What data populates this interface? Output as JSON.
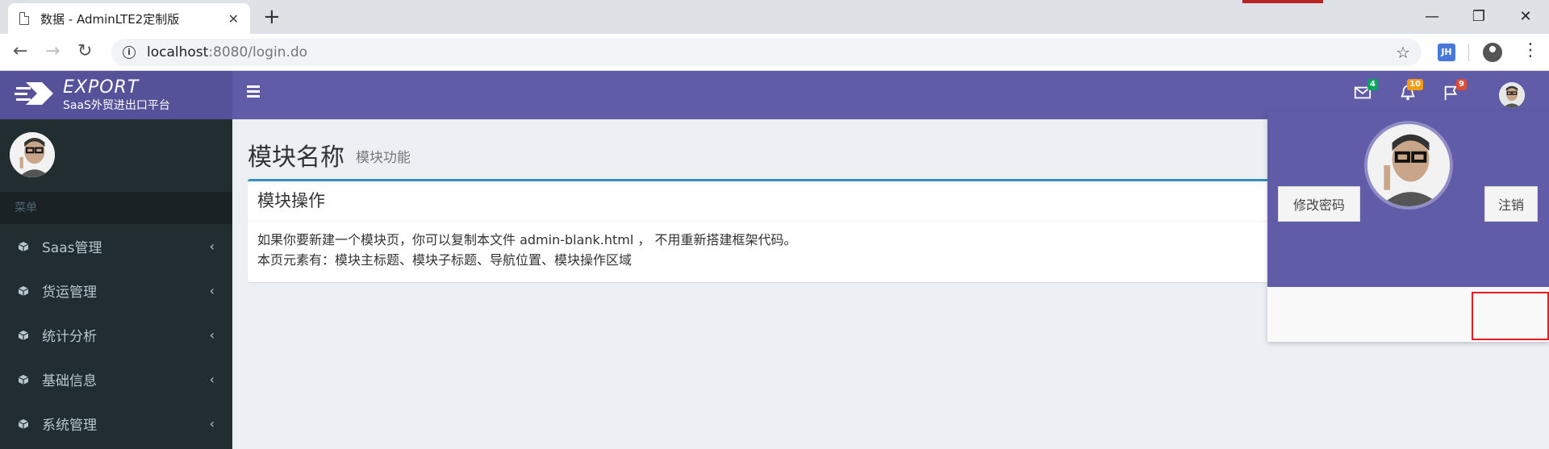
{
  "browser": {
    "tab_title": "数据 - AdminLTE2定制版",
    "tab_close": "✕",
    "new_tab": "+",
    "url_host": "localhost",
    "url_rest": ":8080/login.do",
    "ext_label": "JH",
    "window_controls": {
      "minimize": "—",
      "maximize": "❐",
      "close": "✕"
    }
  },
  "brand": {
    "title": "EXPORT",
    "subtitle": "SaaS外贸进出口平台"
  },
  "navbar": {
    "mail_count": "4",
    "notify_count": "10",
    "flag_count": "9",
    "badge_colors": {
      "mail": "#00a65a",
      "notify": "#f39c12",
      "flag": "#dd4b39"
    }
  },
  "sidebar": {
    "header": "菜单",
    "items": [
      {
        "label": "Saas管理"
      },
      {
        "label": "货运管理"
      },
      {
        "label": "统计分析"
      },
      {
        "label": "基础信息"
      },
      {
        "label": "系统管理"
      }
    ],
    "chevron": "‹"
  },
  "content": {
    "title": "模块名称",
    "subtitle": "模块功能",
    "box_title": "模块操作",
    "body_line1": "如果你要新建一个模块页，你可以复制本文件 admin-blank.html ， 不用重新搭建框架代码。",
    "body_line2": "本页元素有：模块主标题、模块子标题、导航位置、模块操作区域"
  },
  "user_menu": {
    "change_password": "修改密码",
    "logout": "注销"
  },
  "colors": {
    "primary": "#605ca8",
    "logo_bg": "#555299",
    "sidebar_bg": "#222d32",
    "box_border": "#3c8dbc",
    "highlight": "#e31b23"
  }
}
